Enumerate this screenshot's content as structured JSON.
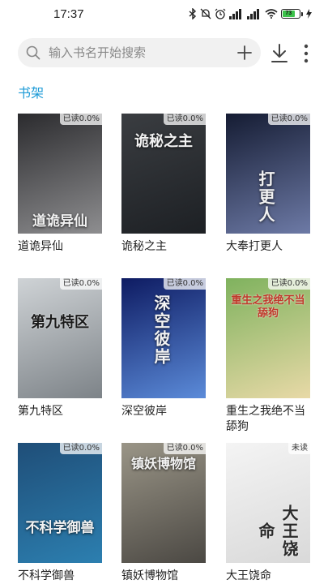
{
  "status_bar": {
    "time": "17:37",
    "battery": "73",
    "icons": [
      "bluetooth-icon",
      "mute-icon",
      "alarm-icon",
      "signal-icon",
      "signal-icon",
      "wifi-icon",
      "battery-icon",
      "charging-icon"
    ]
  },
  "search": {
    "placeholder": "输入书名开始搜索",
    "icon": "search-icon",
    "add_icon": "plus-icon"
  },
  "toolbar": {
    "download_icon": "download-icon",
    "more_icon": "more-vertical-icon"
  },
  "shelf": {
    "title": "书架",
    "accent": "#1e9bd7",
    "books": [
      {
        "title": "道诡异仙",
        "badge": "已读0.0%",
        "cover_text": "道诡异仙",
        "palette": [
          "#2b2b2e",
          "#8e8e90"
        ]
      },
      {
        "title": "诡秘之主",
        "badge": "已读0.0%",
        "cover_text": "诡秘之主",
        "palette": [
          "#3a3d41",
          "#1d2024"
        ]
      },
      {
        "title": "大奉打更人",
        "badge": "已读0.0%",
        "cover_text": "打更人",
        "palette": [
          "#151c33",
          "#6d7aa6"
        ]
      },
      {
        "title": "第九特区",
        "badge": "已读0.0%",
        "cover_text": "第九特区",
        "palette": [
          "#cfd3d6",
          "#7d8388"
        ]
      },
      {
        "title": "深空彼岸",
        "badge": "已读0.0%",
        "cover_text": "深空彼岸",
        "palette": [
          "#0e1b62",
          "#5b8bd9"
        ]
      },
      {
        "title": "重生之我绝不当舔狗",
        "badge": "已读0.0%",
        "cover_text": "重生之我绝不当舔狗",
        "palette": [
          "#7fb25e",
          "#e8d9a7"
        ]
      },
      {
        "title": "不科学御兽",
        "badge": "已读0.0%",
        "cover_text": "不科学御兽",
        "palette": [
          "#1f4e78",
          "#2c7fb0"
        ]
      },
      {
        "title": "镇妖博物馆",
        "badge": "已读0.0%",
        "cover_text": "镇妖博物馆",
        "palette": [
          "#9a9587",
          "#4b4843"
        ]
      },
      {
        "title": "大王饶命",
        "badge": "未读",
        "cover_text": "大王饶命",
        "palette": [
          "#f4f4f4",
          "#d9d9d9"
        ]
      }
    ]
  }
}
